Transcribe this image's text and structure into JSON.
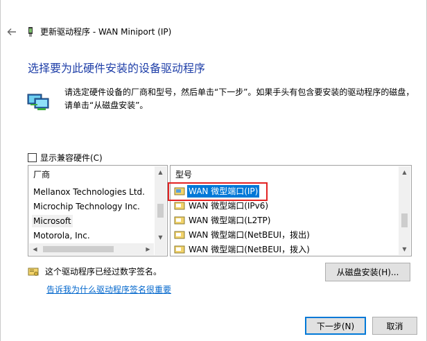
{
  "window": {
    "title": "更新驱动程序 - WAN Miniport (IP)"
  },
  "heading": "选择要为此硬件安装的设备驱动程序",
  "instructions": {
    "line1": "请选定硬件设备的厂商和型号，然后单击“下一步”。如果手头有包含要安装的驱动程序的磁盘，",
    "line2": "请单击“从磁盘安装”。"
  },
  "compat_checkbox": {
    "label": "显示兼容硬件(C)",
    "checked": false
  },
  "manufacturers": {
    "header": "厂商",
    "items": [
      "Mellanox Technologies Ltd.",
      "Microchip Technology Inc.",
      "Microsoft",
      "Motorola, Inc."
    ],
    "selected": "Microsoft"
  },
  "models": {
    "header": "型号",
    "items": [
      "WAN 微型端口(IP)",
      "WAN 微型端口(IPv6)",
      "WAN 微型端口(L2TP)",
      "WAN 微型端口(NetBEUI，拨出)",
      "WAN 微型端口(NetBEUI，拨入)"
    ],
    "selected": "WAN 微型端口(IP)"
  },
  "signature": {
    "text": "这个驱动程序已经过数字签名。",
    "link": "告诉我为什么驱动程序签名很重要"
  },
  "buttons": {
    "have_disk": "从磁盘安装(H)...",
    "next": "下一步(N)",
    "cancel": "取消"
  },
  "icons": {
    "back": "back-arrow-icon",
    "title": "network-adapter-icon",
    "hardware": "network-computers-icon",
    "driver": "driver-package-icon",
    "signed": "signed-certificate-icon"
  },
  "colors": {
    "heading": "#1f3fa8",
    "selection": "#0078d7",
    "link": "#0066cc",
    "highlight_box": "#e22222"
  }
}
